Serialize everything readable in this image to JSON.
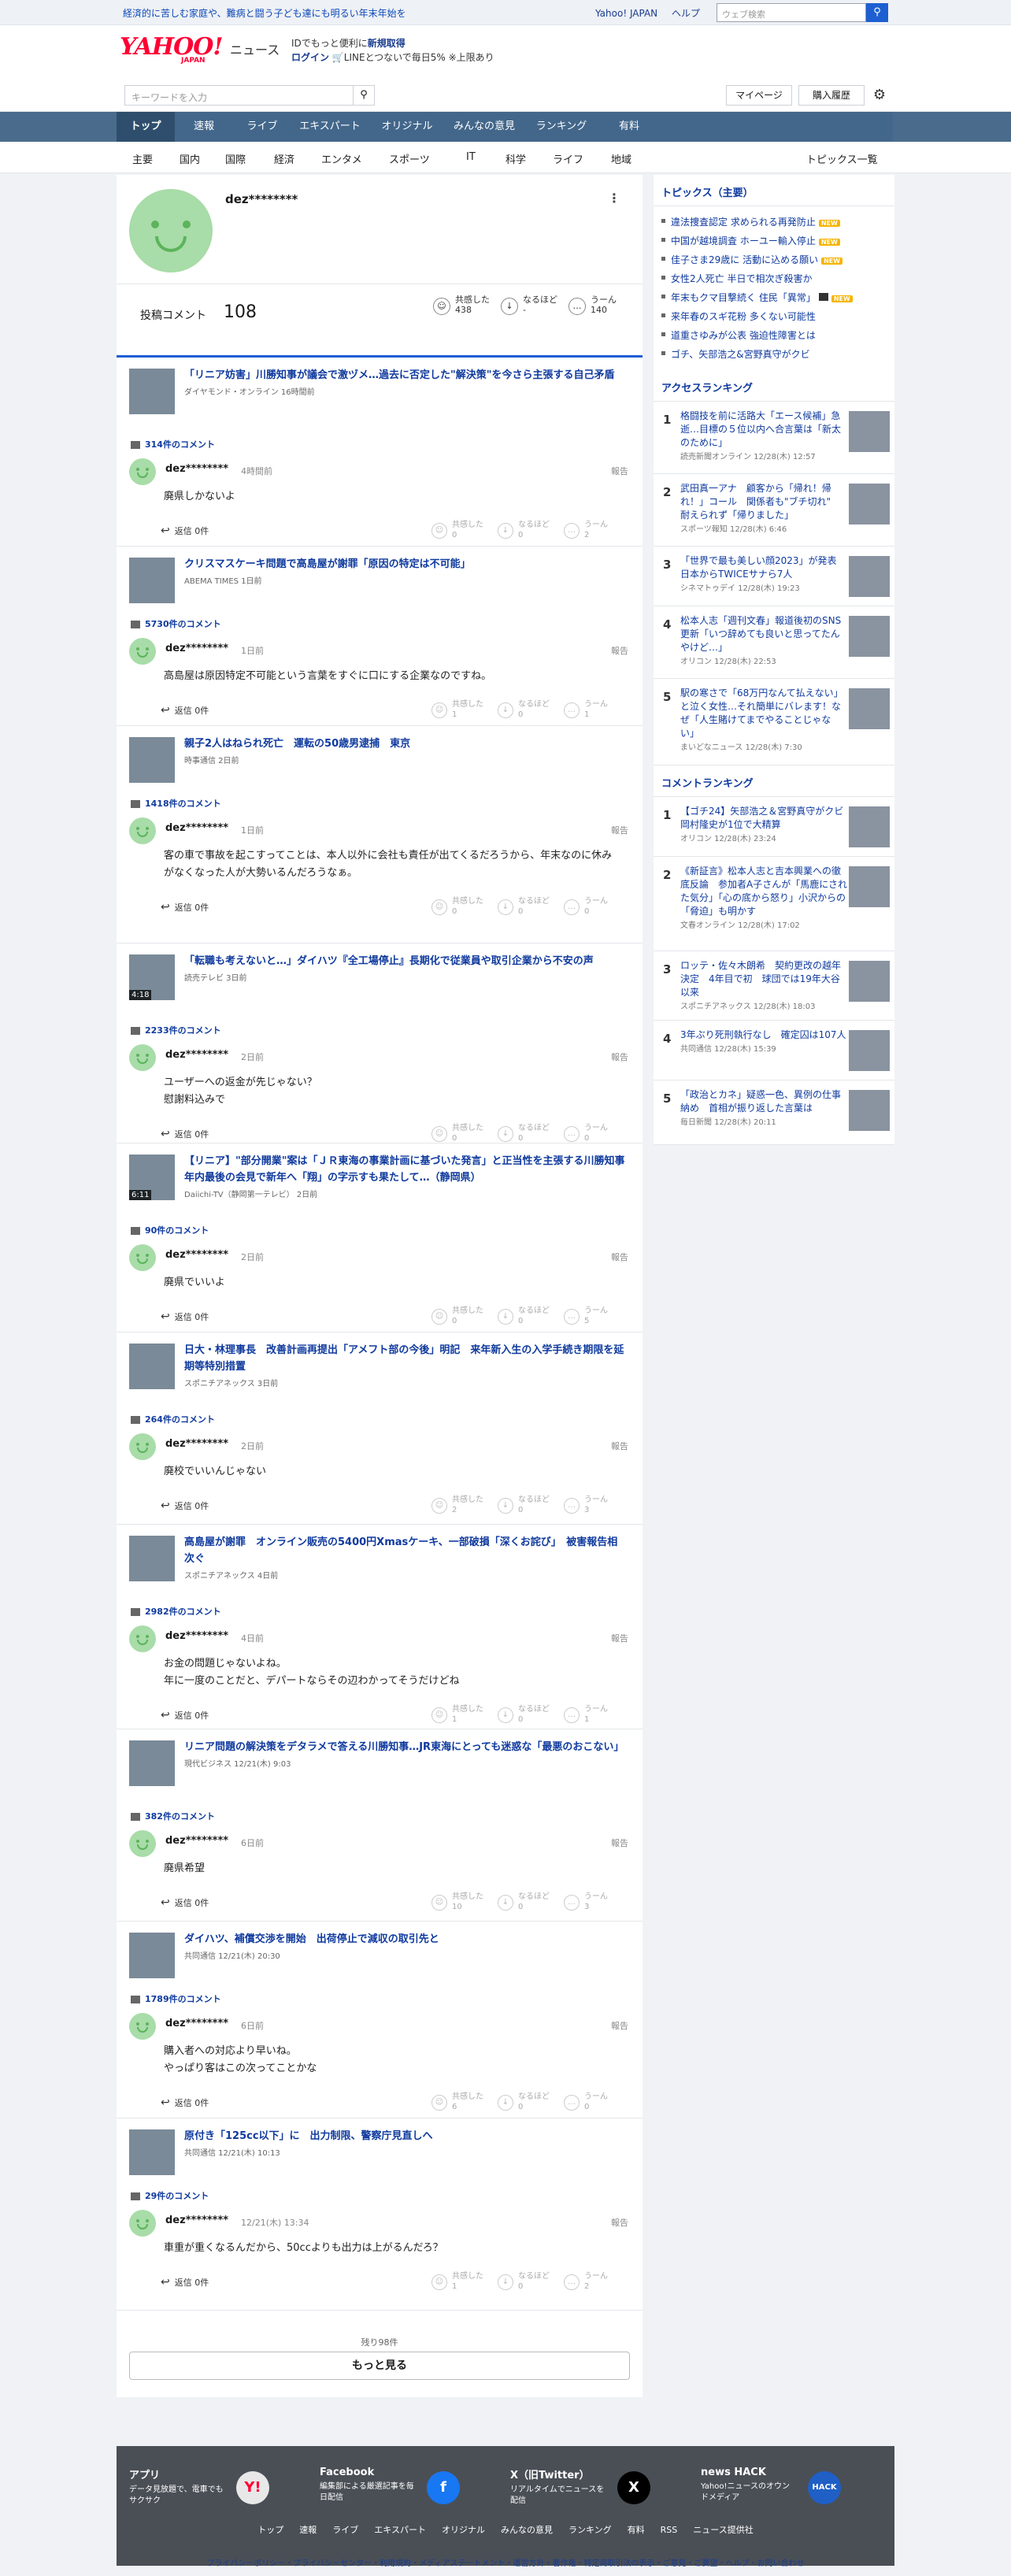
{
  "topstrip": {
    "promo": "経済的に苦しむ家庭や、難病と闘う子ども達にも明るい年末年始を",
    "links": [
      "Yahoo! JAPAN",
      "ヘルプ"
    ],
    "search_placeholder": "ウェブ検索"
  },
  "header": {
    "logo": "YAHOO!",
    "logo_sub": "JAPAN",
    "service": "ニュース",
    "line1_a": "IDでもっと便利に",
    "line1_b": "新規取得",
    "line2_a": "ログイン",
    "line2_b": "LINEとつないで毎日5% ※上限あり"
  },
  "searchbar": {
    "placeholder": "キーワードを入力",
    "mypage": "マイページ",
    "history": "購入履歴"
  },
  "global_nav": [
    "トップ",
    "速報",
    "ライブ",
    "エキスパート",
    "オリジナル",
    "みんなの意見",
    "ランキング",
    "有料"
  ],
  "sub_nav": [
    "主要",
    "国内",
    "国際",
    "経済",
    "エンタメ",
    "スポーツ",
    "IT",
    "科学",
    "ライフ",
    "地域"
  ],
  "topics_list_label": "トピックス一覧",
  "profile": {
    "name": "dez********",
    "comment_label": "投稿コメント",
    "comment_count": "108",
    "reactions": [
      {
        "label": "共感した",
        "value": "438"
      },
      {
        "label": "なるほど",
        "value": "-"
      },
      {
        "label": "うーん",
        "value": "140"
      }
    ]
  },
  "articles": [
    {
      "title": "「リニア妨害」川勝知事が議会で激ヅメ…過去に否定した\"解決策\"を今さら主張する自己矛盾",
      "source": "ダイヤモンド・オンライン 16時間前",
      "comments": "314件のコメント",
      "time": "4時間前",
      "text": "廃県しかないよ",
      "agree": "0",
      "hmm": "0",
      "uun": "2"
    },
    {
      "title": "クリスマスケーキ問題で高島屋が謝罪「原因の特定は不可能」",
      "source": "ABEMA TIMES 1日前",
      "comments": "5730件のコメント",
      "time": "1日前",
      "text": "高島屋は原因特定不可能という言葉をすぐに口にする企業なのですね。",
      "agree": "1",
      "hmm": "0",
      "uun": "1"
    },
    {
      "title": "親子2人はねられ死亡　運転の50歳男逮捕　東京",
      "source": "時事通信 2日前",
      "comments": "1418件のコメント",
      "time": "1日前",
      "text": "客の車で事故を起こすってことは、本人以外に会社も責任が出てくるだろうから、年末なのに休みがなくなった人が大勢いるんだろうなぁ。",
      "agree": "0",
      "hmm": "0",
      "uun": "0"
    },
    {
      "title": "「転職も考えないと…」ダイハツ『全工場停止』長期化で従業員や取引企業から不安の声",
      "source": "読売テレビ 3日前",
      "duration": "4:18",
      "comments": "2233件のコメント",
      "time": "2日前",
      "text": "ユーザーへの返金が先じゃない？\n慰謝料込みで",
      "agree": "0",
      "hmm": "0",
      "uun": "0"
    },
    {
      "title": "【リニア】\"部分開業\"案は「ＪＲ東海の事業計画に基づいた発言」と正当性を主張する川勝知事　年内最後の会見で新年へ「翔」の字示すも果たして…（静岡県）",
      "source": "Daiichi-TV（静岡第一テレビ） 2日前",
      "duration": "6:11",
      "comments": "90件のコメント",
      "time": "2日前",
      "text": "廃県でいいよ",
      "agree": "0",
      "hmm": "0",
      "uun": "5"
    },
    {
      "title": "日大・林理事長　改善計画再提出「アメフト部の今後」明記　来年新入生の入学手続き期限を延期等特別措置",
      "source": "スポニチアネックス 3日前",
      "comments": "264件のコメント",
      "time": "2日前",
      "text": "廃校でいいんじゃない",
      "agree": "2",
      "hmm": "0",
      "uun": "3"
    },
    {
      "title": "高島屋が謝罪　オンライン販売の5400円Xmasケーキ、一部破損「深くお詫び」　被害報告相次ぐ",
      "source": "スポニチアネックス 4日前",
      "comments": "2982件のコメント",
      "time": "4日前",
      "text": "お金の問題じゃないよね。\n年に一度のことだと、デパートならその辺わかってそうだけどね",
      "agree": "1",
      "hmm": "0",
      "uun": "1"
    },
    {
      "title": "リニア問題の解決策をデタラメで答える川勝知事…JR東海にとっても迷惑な「最悪のおこない」",
      "source": "現代ビジネス 12/21(木) 9:03",
      "comments": "382件のコメント",
      "time": "6日前",
      "text": "廃県希望",
      "agree": "10",
      "hmm": "0",
      "uun": "3"
    },
    {
      "title": "ダイハツ、補償交渉を開始　出荷停止で減収の取引先と",
      "source": "共同通信 12/21(木) 20:30",
      "comments": "1789件のコメント",
      "time": "6日前",
      "text": "購入者への対応より早いね。\nやっぱり客はこの次ってことかな",
      "agree": "6",
      "hmm": "0",
      "uun": "0"
    },
    {
      "title": "原付き「125cc以下」に　出力制限、警察庁見直しへ",
      "source": "共同通信 12/21(木) 10:13",
      "comments": "29件のコメント",
      "time": "12/21(木) 13:34",
      "text": "車重が重くなるんだから、50ccよりも出力は上がるんだろ？",
      "agree": "1",
      "hmm": "0",
      "uun": "2"
    }
  ],
  "comment_ui": {
    "reply": "返信 0件",
    "report": "報告",
    "agree": "共感した",
    "hmm": "なるほど",
    "uun": "うーん"
  },
  "more": {
    "remaining": "残り98件",
    "button": "もっと見る"
  },
  "sidebar": {
    "topics_title": "トピックス（主要）",
    "topics": [
      {
        "t": "違法捜査認定 求められる再発防止",
        "new": true
      },
      {
        "t": "中国が越境調査 ホーユー輸入停止",
        "new": true
      },
      {
        "t": "佳子さま29歳に 活動に込める願い",
        "new": true
      },
      {
        "t": "女性2人死亡 半日で相次ぎ殺害か",
        "new": false
      },
      {
        "t": "年末もクマ目撃続く 住民「異常」",
        "new": true,
        "video": true
      },
      {
        "t": "来年春のスギ花粉 多くない可能性",
        "new": false
      },
      {
        "t": "道重さゆみが公表 強迫性障害とは",
        "new": false
      },
      {
        "t": "ゴチ、矢部浩之&宮野真守がクビ",
        "new": false
      }
    ],
    "new_label": "NEW",
    "access_title": "アクセスランキング",
    "access": [
      {
        "n": "1",
        "t": "格闘技を前に活路大「エース候補」急逝…目標の５位以内へ合言葉は「新太のために」",
        "s": "読売新聞オンライン 12/28(木) 12:57"
      },
      {
        "n": "2",
        "t": "武田真一アナ　顧客から「帰れ！帰れ！」コール　関係者も\"ブチ切れ\"　耐えられず「帰りました」",
        "s": "スポーツ報知 12/28(木) 6:46"
      },
      {
        "n": "3",
        "t": "「世界で最も美しい顔2023」が発表　日本からTWICEサナら7人",
        "s": "シネマトゥデイ 12/28(木) 19:23"
      },
      {
        "n": "4",
        "t": "松本人志「週刊文春」報道後初のSNS更新「いつ辞めても良いと思ってたんやけど…」",
        "s": "オリコン 12/28(木) 22:53"
      },
      {
        "n": "5",
        "t": "駅の寒さで「68万円なんて払えない」と泣く女性…それ簡単にバレます！なぜ「人生賭けてまでやることじゃない」",
        "s": "まいどなニュース 12/28(木) 7:30"
      }
    ],
    "comment_title": "コメントランキング",
    "comment": [
      {
        "n": "1",
        "t": "【ゴチ24】矢部浩之＆宮野真守がクビ　岡村隆史が1位で大精算",
        "s": "オリコン 12/28(木) 23:24"
      },
      {
        "n": "2",
        "t": "《新証言》松本人志と吉本興業への徹底反論　参加者A子さんが「馬鹿にされた気分」「心の底から怒り」小沢からの「脅迫」も明かす",
        "s": "文春オンライン 12/28(木) 17:02"
      },
      {
        "n": "3",
        "t": "ロッテ・佐々木朗希　契約更改の越年決定　4年目で初　球団では19年大谷以来",
        "s": "スポニチアネックス 12/28(木) 18:03"
      },
      {
        "n": "4",
        "t": "3年ぶり死刑執行なし　確定囚は107人",
        "s": "共同通信 12/28(木) 15:39"
      },
      {
        "n": "5",
        "t": "「政治とカネ」疑惑一色、異例の仕事納め　首相が振り返した言葉は",
        "s": "毎日新聞 12/28(木) 20:11"
      }
    ]
  },
  "footer": {
    "cols": [
      {
        "t": "アプリ",
        "d": "データ見放題で、電車でもサクサク",
        "i": "Y!"
      },
      {
        "t": "Facebook",
        "d": "編集部による厳選記事を毎日配信",
        "i": "f"
      },
      {
        "t": "X（旧Twitter）",
        "d": "リアルタイムでニュースを配信",
        "i": "X"
      },
      {
        "t": "news HACK",
        "d": "Yahoo!ニュースのオウンドメディア",
        "i": "HACK"
      }
    ],
    "links": [
      "トップ",
      "速報",
      "ライブ",
      "エキスパート",
      "オリジナル",
      "みんなの意見",
      "ランキング",
      "有料",
      "RSS",
      "ニュース提供社"
    ],
    "legal": "プライバシーポリシー・プライバシーセンター・利用規約・メディアステートメント・運営方針・著作権・特定商取引法の表示・ご意見・ご要望・ヘルプ・お問い合わせ"
  }
}
